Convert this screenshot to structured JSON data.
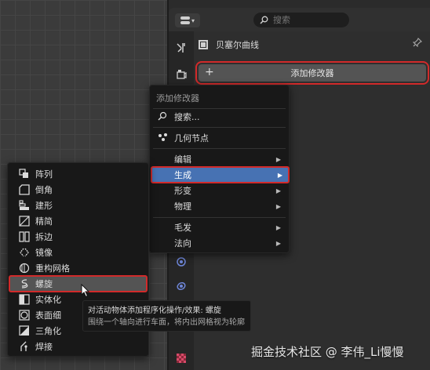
{
  "properties": {
    "search_placeholder": "搜索",
    "object_name": "贝塞尔曲线",
    "add_modifier_label": "添加修改器"
  },
  "menu": {
    "title": "添加修改器",
    "search_label": "搜索...",
    "geometry_nodes_label": "几何节点",
    "items": [
      {
        "label": "编辑"
      },
      {
        "label": "生成"
      },
      {
        "label": "形变"
      },
      {
        "label": "物理"
      },
      {
        "label": "毛发"
      },
      {
        "label": "法向"
      }
    ]
  },
  "submenu": {
    "items": [
      {
        "label": "阵列",
        "icon": "array-icon"
      },
      {
        "label": "倒角",
        "icon": "bevel-icon"
      },
      {
        "label": "建形",
        "icon": "build-icon"
      },
      {
        "label": "精简",
        "icon": "decimate-icon"
      },
      {
        "label": "拆边",
        "icon": "edge-split-icon"
      },
      {
        "label": "镜像",
        "icon": "mirror-icon"
      },
      {
        "label": "重构网格",
        "icon": "remesh-icon"
      },
      {
        "label": "螺旋",
        "icon": "screw-icon"
      },
      {
        "label": "实体化",
        "icon": "solidify-icon"
      },
      {
        "label": "表面细",
        "icon": "subdivision-icon"
      },
      {
        "label": "三角化",
        "icon": "triangulate-icon"
      },
      {
        "label": "焊接",
        "icon": "weld-icon"
      }
    ]
  },
  "tooltip": {
    "line1": "对活动物体添加程序化操作/效果: 螺旋",
    "line2": "围绕一个轴向进行车面，将内出网格视为轮廓"
  },
  "watermark": "掘金技术社区 @ 李伟_Li慢慢",
  "colors": {
    "highlight_blue": "#4772b3",
    "outline_red": "#d12a2a",
    "menu_bg": "#181818"
  }
}
